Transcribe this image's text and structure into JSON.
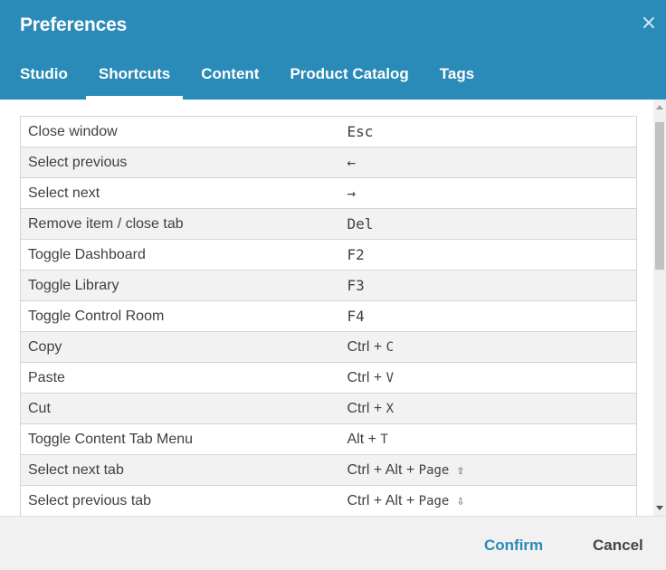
{
  "dialog": {
    "title": "Preferences",
    "close_glyph": "×"
  },
  "tabs": [
    {
      "label": "Studio",
      "active": false
    },
    {
      "label": "Shortcuts",
      "active": true
    },
    {
      "label": "Content",
      "active": false
    },
    {
      "label": "Product Catalog",
      "active": false
    },
    {
      "label": "Tags",
      "active": false
    }
  ],
  "shortcuts": [
    {
      "action": "Close window",
      "keys": "Esc"
    },
    {
      "action": "Select previous",
      "keys": "←"
    },
    {
      "action": "Select next",
      "keys": "→"
    },
    {
      "action": "Remove item / close tab",
      "keys": "Del"
    },
    {
      "action": "Toggle Dashboard",
      "keys": "F2"
    },
    {
      "action": "Toggle Library",
      "keys": "F3"
    },
    {
      "action": "Toggle Control Room",
      "keys": "F4"
    },
    {
      "action": "Copy",
      "keys_mod": "Ctrl + ",
      "keys_key": "C"
    },
    {
      "action": "Paste",
      "keys_mod": "Ctrl + ",
      "keys_key": "V"
    },
    {
      "action": "Cut",
      "keys_mod": "Ctrl + ",
      "keys_key": "X"
    },
    {
      "action": "Toggle Content Tab Menu",
      "keys_mod": "Alt + ",
      "keys_key": "T"
    },
    {
      "action": "Select next tab",
      "keys_mod": "Ctrl + Alt + ",
      "keys_key": "Page ⇧"
    },
    {
      "action": "Select previous tab",
      "keys_mod": "Ctrl + Alt + ",
      "keys_key": "Page ⇩"
    }
  ],
  "footer": {
    "confirm_label": "Confirm",
    "cancel_label": "Cancel"
  },
  "colors": {
    "header": "#2a8ab8",
    "confirm": "#2a8ab8"
  }
}
